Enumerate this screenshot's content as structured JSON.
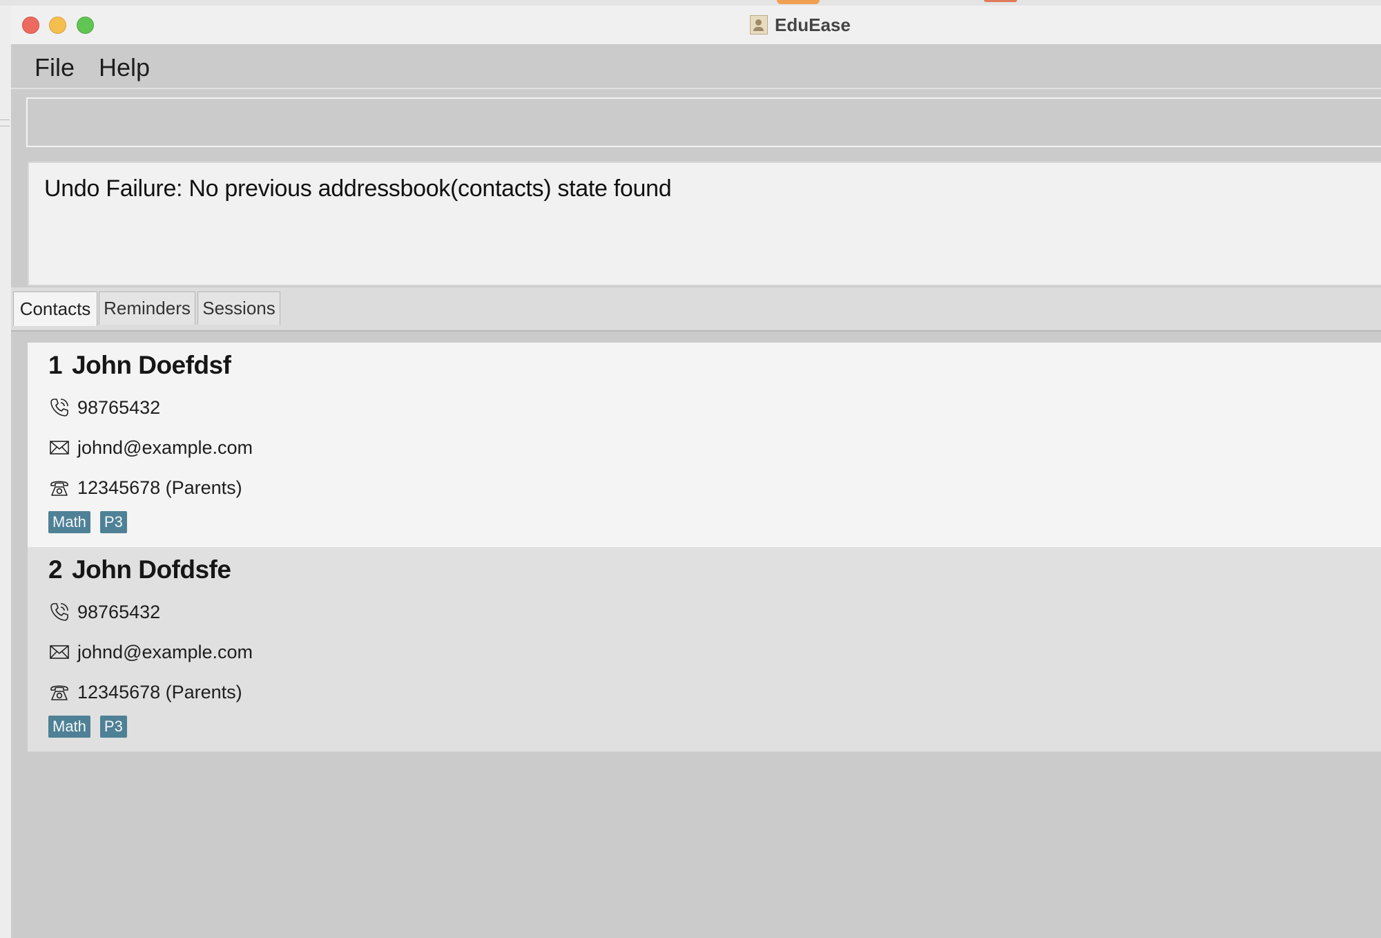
{
  "window": {
    "title": "EduEase"
  },
  "menu": {
    "file": "File",
    "help": "Help"
  },
  "command": {
    "value": "",
    "placeholder": ""
  },
  "result": {
    "message": "Undo Failure: No previous addressbook(contacts) state found"
  },
  "tabs": [
    {
      "label": "Contacts",
      "active": true
    },
    {
      "label": "Reminders",
      "active": false
    },
    {
      "label": "Sessions",
      "active": false
    }
  ],
  "contacts": [
    {
      "index": "1",
      "name": "John Doefdsf",
      "phone": "98765432",
      "email": "johnd@example.com",
      "parent_phone": "12345678 (Parents)",
      "tags": [
        "Math",
        "P3"
      ]
    },
    {
      "index": "2",
      "name": "John Dofdsfe",
      "phone": "98765432",
      "email": "johnd@example.com",
      "parent_phone": "12345678 (Parents)",
      "tags": [
        "Math",
        "P3"
      ]
    }
  ],
  "icons": {
    "phone": "phone-icon",
    "email": "envelope-icon",
    "parent": "telephone-icon",
    "app": "app-icon"
  },
  "colors": {
    "tag_background": "#4f8196",
    "close": "#ed6a5e",
    "minimize": "#f5bf4f",
    "maximize": "#61c554"
  }
}
